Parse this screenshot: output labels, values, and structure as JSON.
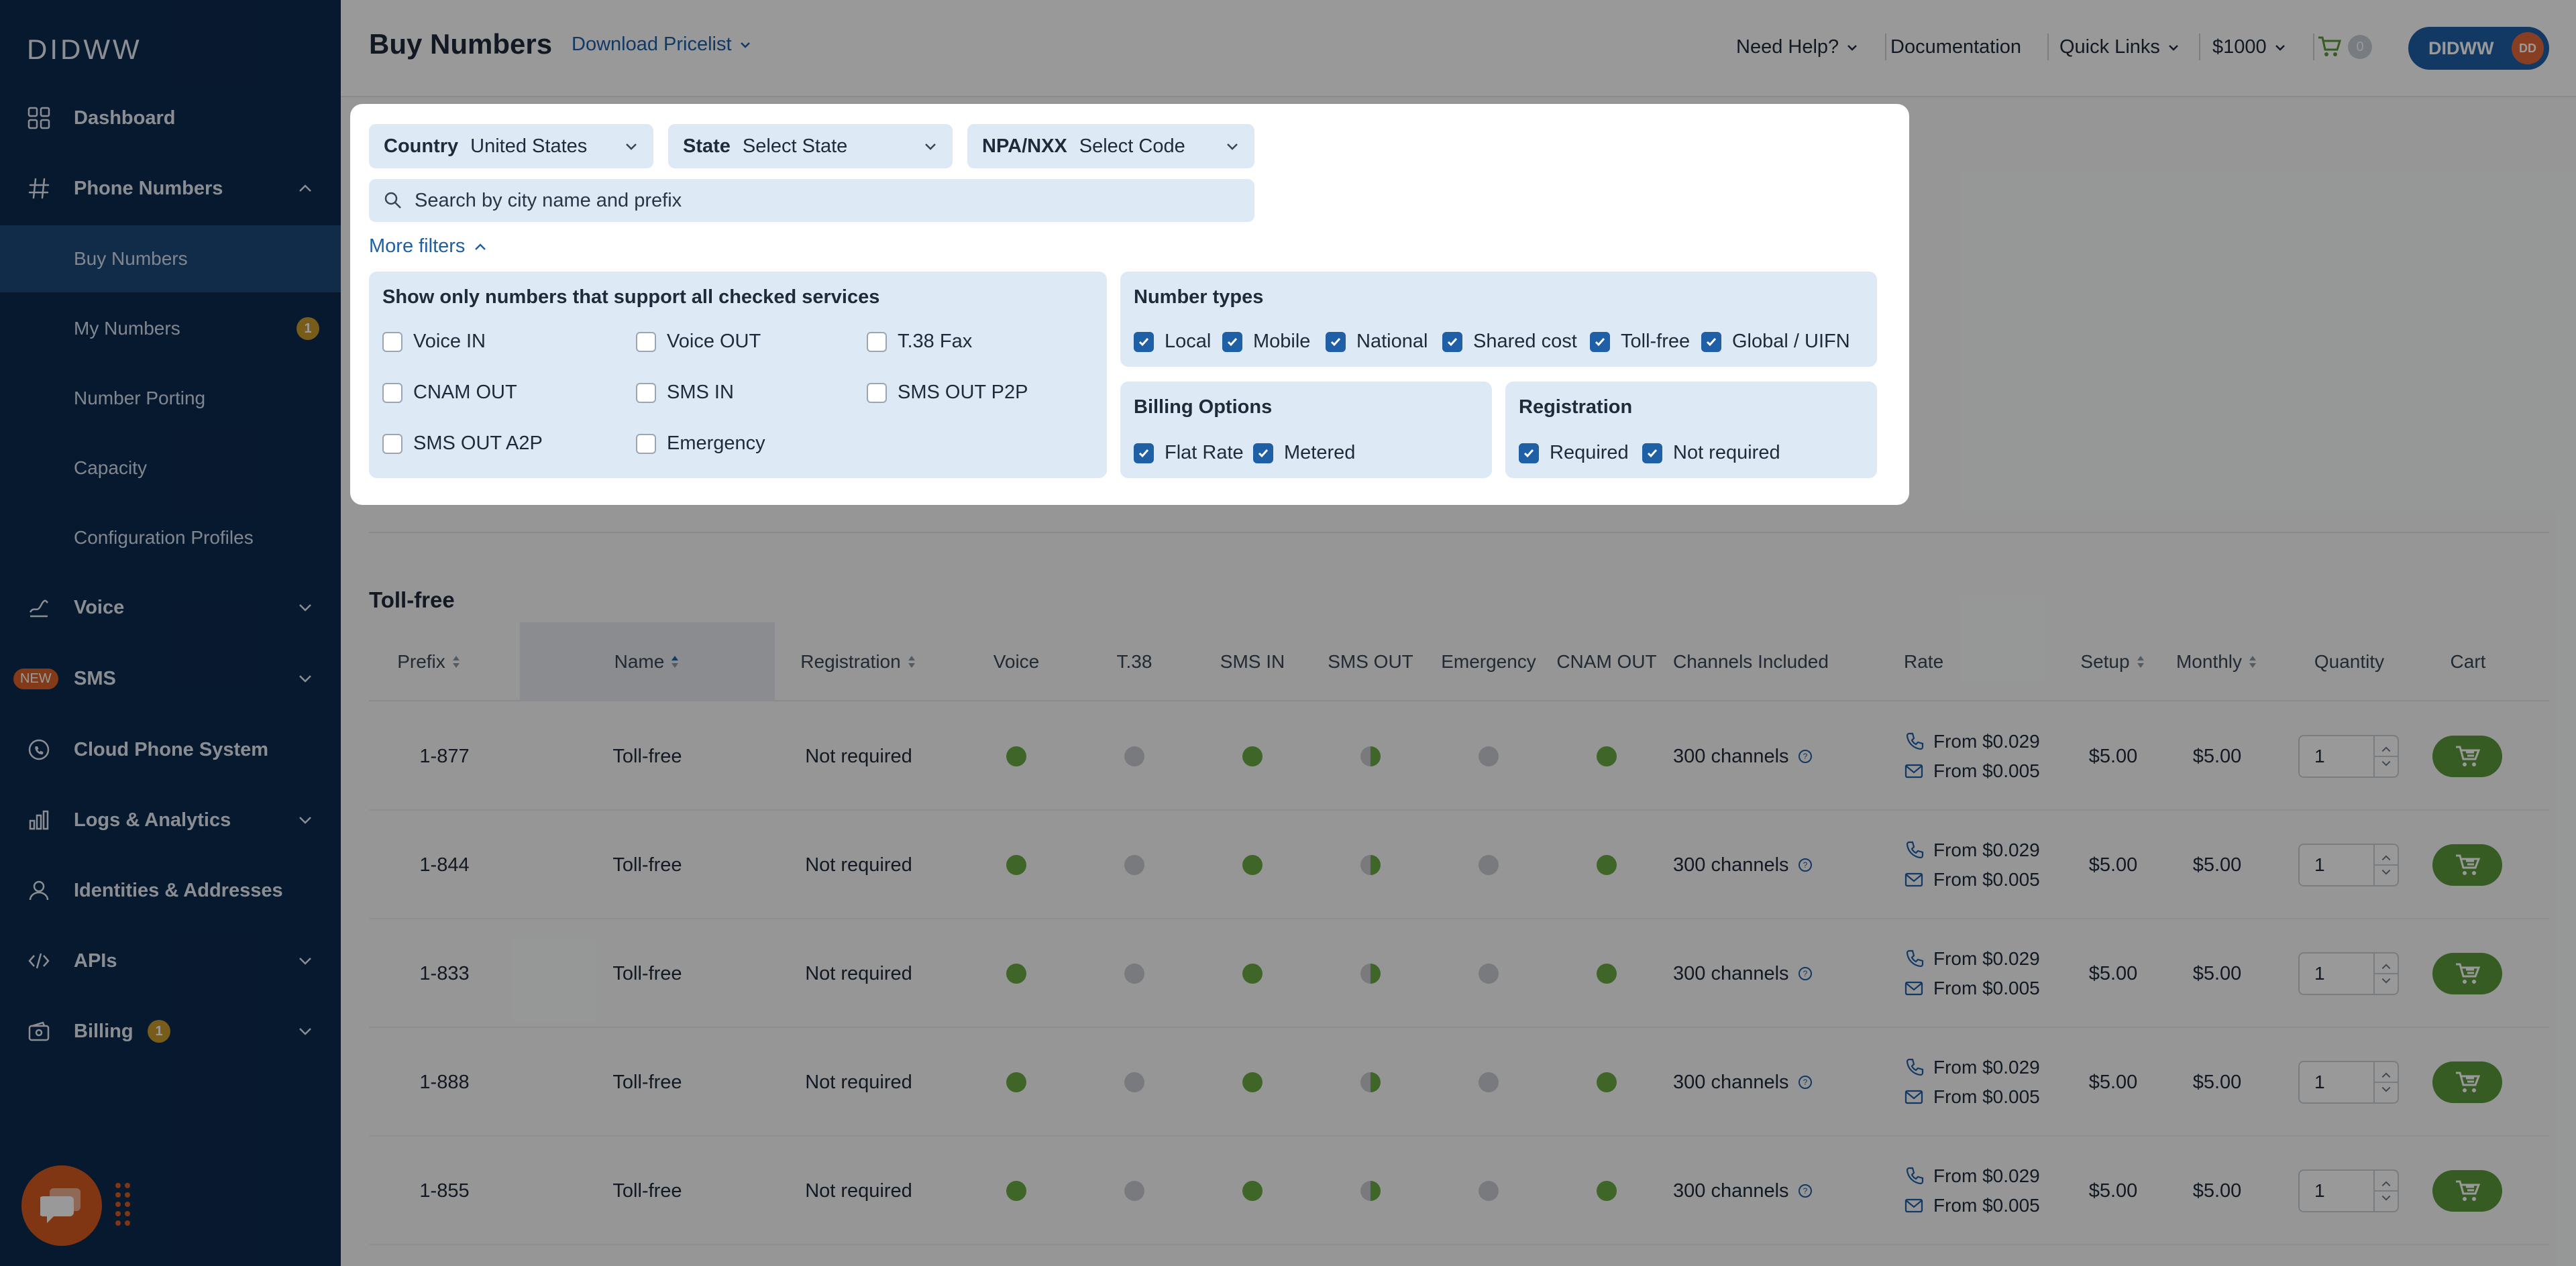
{
  "app": {
    "logo": "DIDWW",
    "page_title": "Buy Numbers",
    "download_pricelist": "Download Pricelist"
  },
  "colors": {
    "sidebar": "#0d2a4f",
    "sidebar_active": "#1c4a7a",
    "accent": "#1f5fa6",
    "cart_green": "#5b9a3b",
    "badge": "#c99a2b"
  },
  "sidebar": {
    "items": [
      {
        "label": "Dashboard",
        "icon": "dashboard-grid-icon"
      },
      {
        "label": "Phone Numbers",
        "icon": "hash-icon"
      },
      {
        "label": "Voice",
        "icon": "voice-icon"
      },
      {
        "label": "SMS",
        "icon": "sms-icon",
        "badge": "NEW"
      },
      {
        "label": "Cloud Phone System",
        "icon": "cloud-phone-icon"
      },
      {
        "label": "Logs & Analytics",
        "icon": "bar-chart-icon"
      },
      {
        "label": "Identities & Addresses",
        "icon": "person-icon"
      },
      {
        "label": "APIs",
        "icon": "code-icon"
      },
      {
        "label": "Billing",
        "icon": "wallet-icon",
        "badge": "1"
      }
    ],
    "sub_items": [
      {
        "label": "Buy Numbers",
        "active": true
      },
      {
        "label": "My Numbers",
        "badge": "1"
      },
      {
        "label": "Number Porting"
      },
      {
        "label": "Capacity"
      },
      {
        "label": "Configuration Profiles"
      }
    ]
  },
  "topbar": {
    "need_help": "Need Help?",
    "documentation": "Documentation",
    "quick_links": "Quick Links",
    "balance": "$1000",
    "cart_count": "0",
    "user": "DIDWW",
    "user_initials": "DD"
  },
  "filters": {
    "country_label": "Country",
    "country_value": "United States",
    "state_label": "State",
    "state_value": "Select State",
    "npa_label": "NPA/NXX",
    "npa_value": "Select Code",
    "search_placeholder": "Search by city name and prefix",
    "more_filters": "More filters",
    "services_title": "Show only numbers that support all checked services",
    "services": [
      "Voice IN",
      "Voice OUT",
      "T.38 Fax",
      "CNAM OUT",
      "SMS IN",
      "SMS OUT P2P",
      "SMS OUT A2P",
      "Emergency"
    ],
    "types_title": "Number types",
    "types": [
      "Local",
      "Mobile",
      "National",
      "Shared cost",
      "Toll-free",
      "Global / UIFN"
    ],
    "billing_title": "Billing Options",
    "billing": [
      "Flat Rate",
      "Metered"
    ],
    "registration_title": "Registration",
    "registration": [
      "Required",
      "Not required"
    ]
  },
  "table": {
    "section_title": "Toll-free",
    "columns": {
      "prefix": "Prefix",
      "name": "Name",
      "registration": "Registration",
      "voice": "Voice",
      "t38": "T.38",
      "sms_in": "SMS IN",
      "sms_out": "SMS OUT",
      "emergency": "Emergency",
      "cnam_out": "CNAM OUT",
      "channels": "Channels Included",
      "rate": "Rate",
      "setup": "Setup",
      "monthly": "Monthly",
      "quantity": "Quantity",
      "cart": "Cart"
    },
    "rows": [
      {
        "prefix": "1-877",
        "name": "Toll-free",
        "registration": "Not required",
        "channels": "300 channels",
        "rate_voice": "From $0.029",
        "rate_sms": "From $0.005",
        "setup": "$5.00",
        "monthly": "$5.00",
        "quantity": "1"
      },
      {
        "prefix": "1-844",
        "name": "Toll-free",
        "registration": "Not required",
        "channels": "300 channels",
        "rate_voice": "From $0.029",
        "rate_sms": "From $0.005",
        "setup": "$5.00",
        "monthly": "$5.00",
        "quantity": "1"
      },
      {
        "prefix": "1-833",
        "name": "Toll-free",
        "registration": "Not required",
        "channels": "300 channels",
        "rate_voice": "From $0.029",
        "rate_sms": "From $0.005",
        "setup": "$5.00",
        "monthly": "$5.00",
        "quantity": "1"
      },
      {
        "prefix": "1-888",
        "name": "Toll-free",
        "registration": "Not required",
        "channels": "300 channels",
        "rate_voice": "From $0.029",
        "rate_sms": "From $0.005",
        "setup": "$5.00",
        "monthly": "$5.00",
        "quantity": "1"
      },
      {
        "prefix": "1-855",
        "name": "Toll-free",
        "registration": "Not required",
        "channels": "300 channels",
        "rate_voice": "From $0.029",
        "rate_sms": "From $0.005",
        "setup": "$5.00",
        "monthly": "$5.00",
        "quantity": "1"
      }
    ]
  }
}
